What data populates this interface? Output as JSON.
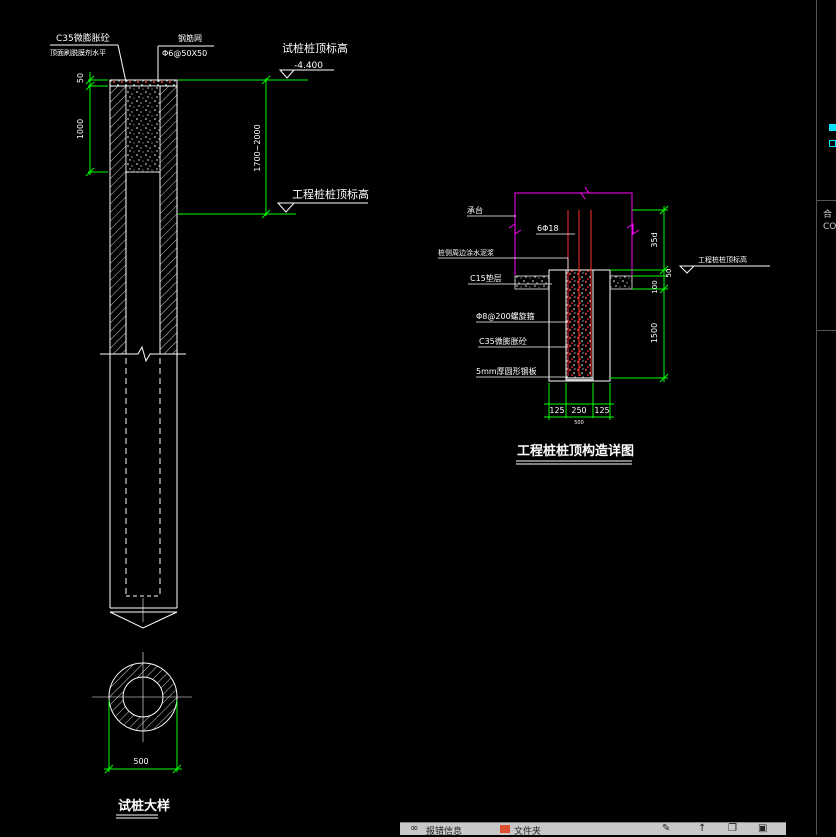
{
  "test_pile": {
    "concrete_note_1": "C35微膨胀砼",
    "concrete_note_2": "顶面刷脱膜剂水平",
    "steel_mesh_title": "钢筋网",
    "steel_mesh_spec": "Φ6@50X50",
    "top_elev_title": "试桩桩顶标高",
    "top_elev_value": "-4.400",
    "work_elev_title": "工程桩桩顶标高",
    "dim_50": "50",
    "dim_1000": "1000",
    "dim_range": "1700~2000",
    "dim_500": "500",
    "title": "试桩大样"
  },
  "detail": {
    "title": "工程桩桩顶构造详图",
    "cap_label": "承台",
    "rebar_label": "6Φ18",
    "waterproof_label": "桩侧周边涂水泥浆",
    "cushion_label": "C15垫层",
    "stirrup_label": "Φ8@200螺旋箍",
    "infill_label": "C35微膨胀砼",
    "plate_label": "5mm厚圆形钢板",
    "elev_label": "工程桩桩顶标高",
    "dim_35d": "35d",
    "dim_100": "100",
    "dim_50": "50",
    "dim_1500": "1500",
    "dim_125a": "125",
    "dim_250": "250",
    "dim_125b": "125",
    "dim_500": "500"
  },
  "ui": {
    "right_panel_text_1": "合",
    "right_panel_text_2": "CO",
    "statusbar_item_1": "报错信息",
    "statusbar_item_2": "文件夹"
  },
  "colors": {
    "background": "#000000",
    "line": "#ffffff",
    "dimension": "#00ff00",
    "cap": "#ff00ff",
    "rebar": "#ff3030",
    "cushion": "#c0c0c0"
  }
}
